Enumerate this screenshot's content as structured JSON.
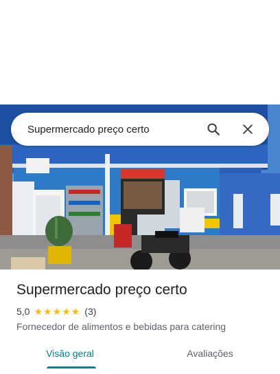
{
  "search": {
    "query": "Supermercado preço certo",
    "search_icon": "search-icon",
    "close_icon": "close-icon"
  },
  "place": {
    "name": "Supermercado preço certo",
    "rating": "5,0",
    "stars": 5,
    "review_count": "(3)",
    "category": "Fornecedor de alimentos e bebidas para catering"
  },
  "tabs": [
    {
      "label": "Visão geral",
      "active": true
    },
    {
      "label": "Avaliações",
      "active": false
    }
  ],
  "colors": {
    "accent": "#00838f",
    "star": "#fbbc04"
  }
}
